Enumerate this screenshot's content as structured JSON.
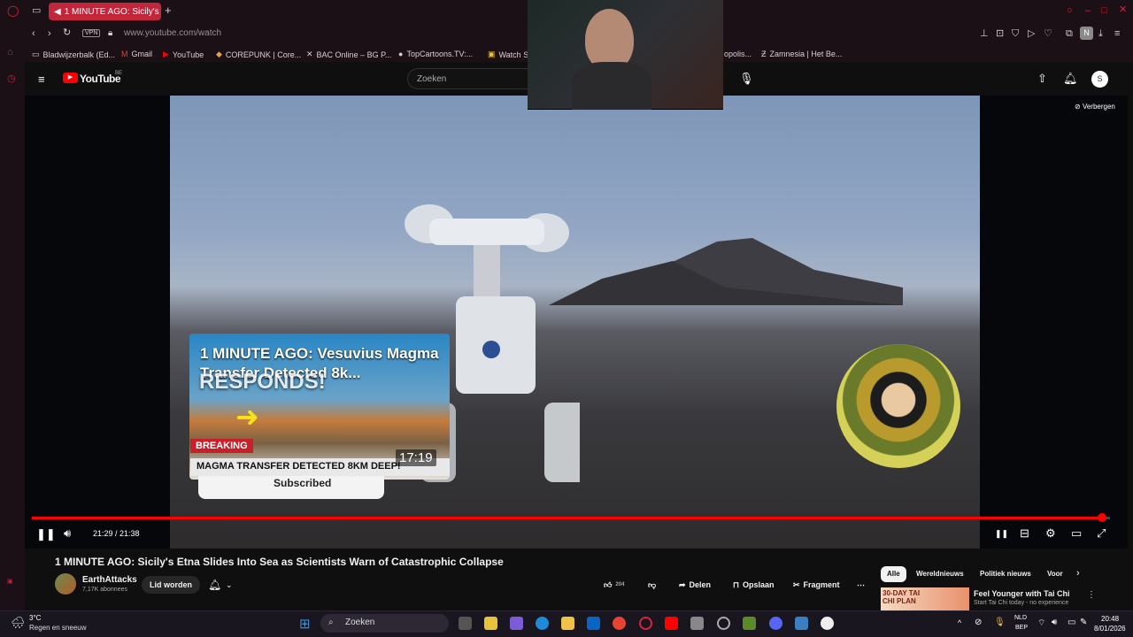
{
  "browser": {
    "tab_title": "1 MINUTE AGO: Sicily's",
    "new_tab_label": "+",
    "vpn_label": "VPN",
    "url": "www.youtube.com/watch",
    "profile_initial": "N",
    "bookmarks": [
      "Bladwijzerbalk (Ed...",
      "Gmail",
      "YouTube",
      "COREPUNK | Core...",
      "BAC Online – BG P...",
      "TopCartoons.TV:...",
      "Watch S",
      "opolis...",
      "Zamnesia | Het Be..."
    ]
  },
  "youtube": {
    "logo_text": "YouTube",
    "country_code": "BE",
    "search_placeholder": "Zoeken",
    "account_initial": "S"
  },
  "video": {
    "endcard": {
      "title": "1 MINUTE AGO: Vesuvius Magma Transfer Detected 8k...",
      "overlay_text": "RESPONDS!",
      "breaking_label": "BREAKING",
      "banner_text": "MAGMA TRANSFER DETECTED 8KM DEEP!",
      "duration": "17:19",
      "subscribe_text": "Subscribed"
    },
    "hide_label": "Verbergen",
    "time_display": "21:29 / 21:38",
    "progress_fraction": 0.993
  },
  "watch": {
    "title": "1 MINUTE AGO: Sicily's Etna Slides Into Sea as Scientists Warn of Catastrophic Collapse",
    "channel_name": "EarthAttacks",
    "subscribers": "7,17K abonnees",
    "join_label": "Lid worden",
    "like_count": "204",
    "share_label": "Delen",
    "save_label": "Opslaan",
    "clip_label": "Fragment",
    "more_label": "⋯"
  },
  "chips": [
    "Alle",
    "Wereldnieuws",
    "Politiek nieuws",
    "Voor"
  ],
  "ad": {
    "thumb_text": "30-DAY TAI CHI PLAN",
    "title": "Feel Younger with Tai Chi",
    "subtitle": "Start Tai Chi today - no experience"
  },
  "taskbar": {
    "temperature": "3°C",
    "weather": "Regen en sneeuw",
    "search_placeholder": "Zoeken",
    "lang_top": "NLD",
    "lang_bottom": "BEP",
    "time": "20:48",
    "date": "8/01/2026"
  }
}
